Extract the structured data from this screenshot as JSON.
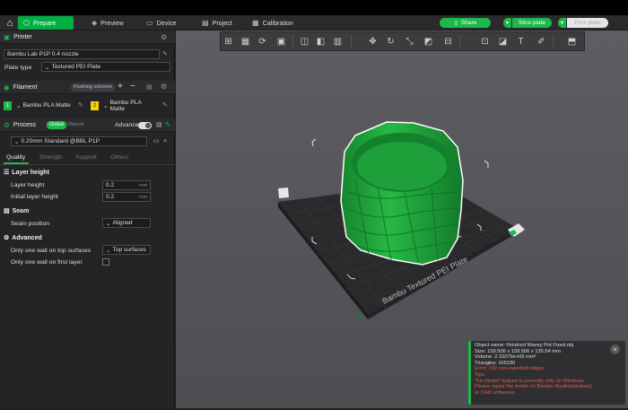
{
  "tabs": [
    {
      "label": "Prepare",
      "icon": "cube-icon"
    },
    {
      "label": "Preview",
      "icon": "layers-icon"
    },
    {
      "label": "Device",
      "icon": "monitor-icon"
    },
    {
      "label": "Project",
      "icon": "project-icon"
    },
    {
      "label": "Calibration",
      "icon": "calibration-icon"
    }
  ],
  "actions": {
    "share": "Share",
    "slice": "Slice plate",
    "print": "Print plate"
  },
  "printer": {
    "section": "Printer",
    "name": "Bambu Lab P1P 0.4 nozzle",
    "plate_label": "Plate type",
    "plate_value": "Textured PEI Plate"
  },
  "filament": {
    "section": "Filament",
    "flushing": "Flushing volumes",
    "slots": [
      {
        "num": "1",
        "name": "Bambu PLA Matte",
        "color": "#1cb84a"
      },
      {
        "num": "2",
        "name": "Bambu PLA Matte",
        "color": "#f5d400"
      }
    ]
  },
  "process": {
    "section": "Process",
    "global": "Global",
    "objects": "Objects",
    "advanced": "Advanced",
    "preset": "0.20mm Standard @BBL P1P",
    "subtabs": [
      "Quality",
      "Strength",
      "Support",
      "Others"
    ],
    "layer_height_header": "Layer height",
    "layer_height_label": "Layer height",
    "layer_height_value": "0.2",
    "initial_layer_label": "Initial layer height",
    "initial_layer_value": "0.2",
    "unit": "mm",
    "seam_header": "Seam",
    "seam_label": "Seam position",
    "seam_value": "Aligned",
    "advanced_header": "Advanced",
    "top_wall_label": "Only one wall on top surfaces",
    "top_wall_value": "Top surfaces",
    "first_layer_label": "Only one wall on first layer"
  },
  "plate_text": "Bambu Textured PEI Plate",
  "object_info": {
    "name": "Object name: Finished Wavey Pot Fixed.obj",
    "size": "Size: 159.506 x 159.506 x 135.54 mm",
    "volume": "Volume: 2.15079e+06 mm³",
    "triangles": "Triangles: 165190",
    "error": "Error: 192 non-manifold edges.",
    "tips": "Tips:",
    "tip1": "\"Fix Model\" feature is currently only on Windows.",
    "tip2": "Please repair the model on Bambu Studio(windows)",
    "tip3": "or CAD softwares."
  },
  "colors": {
    "accent": "#00ae42",
    "model": "#1fae3d",
    "error": "#e85a4f"
  }
}
